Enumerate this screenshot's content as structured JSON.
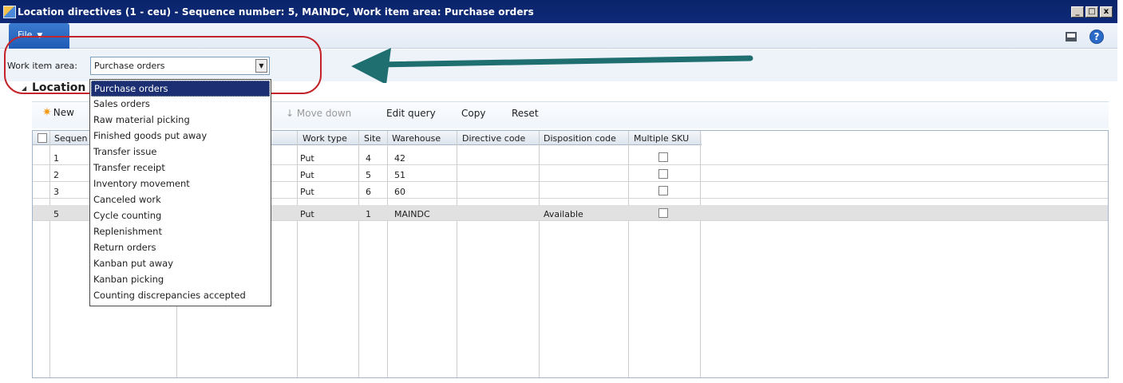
{
  "window": {
    "title": "Location directives (1 - ceu) - Sequence number: 5, MAINDC, Work item area: Purchase orders",
    "controls": [
      "_",
      "□",
      "x"
    ]
  },
  "ribbon": {
    "file_label": "File",
    "help_label": "?"
  },
  "filter": {
    "label": "Work item area:",
    "value": "Purchase orders",
    "options": [
      "Purchase orders",
      "Sales orders",
      "Raw material picking",
      "Finished goods put away",
      "Transfer issue",
      "Transfer receipt",
      "Inventory movement",
      "Canceled work",
      "Cycle counting",
      "Replenishment",
      "Return orders",
      "Kanban put away",
      "Kanban picking",
      "Counting discrepancies accepted"
    ]
  },
  "section": {
    "title": "Location"
  },
  "actions": {
    "new": "New",
    "move_down": "Move down",
    "edit_query": "Edit query",
    "copy": "Copy",
    "reset": "Reset"
  },
  "grid": {
    "headers": {
      "sequence": "Sequen",
      "work_type": "Work type",
      "site": "Site",
      "warehouse": "Warehouse",
      "directive_code": "Directive code",
      "disposition_code": "Disposition code",
      "multiple_sku": "Multiple SKU"
    },
    "rows": [
      {
        "seq": "1",
        "work_type": "Put",
        "site": "4",
        "warehouse": "42",
        "directive_code": "",
        "disposition_code": ""
      },
      {
        "seq": "2",
        "work_type": "Put",
        "site": "5",
        "warehouse": "51",
        "directive_code": "",
        "disposition_code": ""
      },
      {
        "seq": "3",
        "work_type": "Put",
        "site": "6",
        "warehouse": "60",
        "directive_code": "",
        "disposition_code": ""
      },
      {
        "seq": "5",
        "work_type": "Put",
        "site": "1",
        "warehouse": "MAINDC",
        "directive_code": "",
        "disposition_code": "Available"
      }
    ]
  },
  "colors": {
    "title_bar": "#0a246a",
    "highlight": "#c42329",
    "arrow": "#1f6e70",
    "selection": "#1b2f72"
  }
}
